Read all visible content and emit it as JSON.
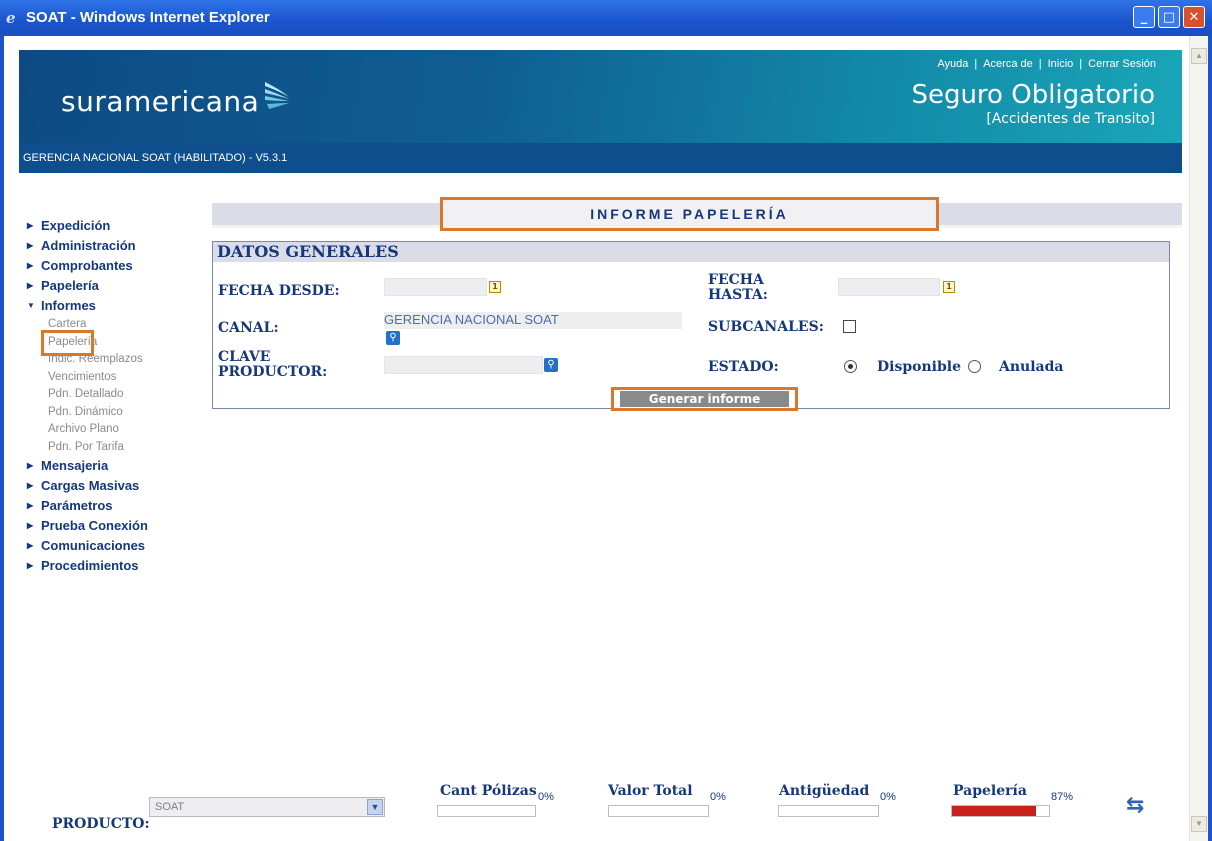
{
  "window": {
    "title": "SOAT - Windows Internet Explorer"
  },
  "header": {
    "logo": "suramericana",
    "links": [
      "Ayuda",
      "Acerca de",
      "Inicio",
      "Cerrar Sesión"
    ],
    "brand_title": "Seguro Obligatorio",
    "brand_subtitle": "[Accidentes de Transito]",
    "subtitle_bar": "GERENCIA NACIONAL SOAT (HABILITADO) - V5.3.1"
  },
  "menu": {
    "items": [
      {
        "label": "Expedición"
      },
      {
        "label": "Administración"
      },
      {
        "label": "Comprobantes"
      },
      {
        "label": "Papelería"
      },
      {
        "label": "Informes",
        "open": true
      }
    ],
    "subitems": [
      "Cartera",
      "Papelería",
      "Indic. Reemplazos",
      "Vencimientos",
      "Pdn. Detallado",
      "Pdn. Dinámico",
      "Archivo Plano",
      "Pdn. Por Tarifa"
    ],
    "items_after": [
      "Mensajeria",
      "Cargas Masivas",
      "Parámetros",
      "Prueba Conexión",
      "Comunicaciones",
      "Procedimientos"
    ]
  },
  "report": {
    "title": "INFORME PAPELERÍA",
    "panel_title": "DATOS GENERALES",
    "fecha_desde_label": "FECHA DESDE:",
    "fecha_hasta_label": "FECHA HASTA:",
    "canal_label": "CANAL:",
    "canal_value": "GERENCIA NACIONAL SOAT",
    "subcanales_label": "SUBCANALES:",
    "clave_label": "CLAVE PRODUCTOR:",
    "estado_label": "ESTADO:",
    "estado_options": [
      "Disponible",
      "Anulada"
    ],
    "estado_selected": "Disponible",
    "generate_button": "Generar informe"
  },
  "footer": {
    "producto_label": "PRODUCTO:",
    "producto_value": "SOAT",
    "indicators": [
      {
        "label": "Cant Pólizas",
        "pct": "0%",
        "value": 0
      },
      {
        "label": "Valor Total",
        "pct": "0%",
        "value": 0
      },
      {
        "label": "Antigüedad",
        "pct": "0%",
        "value": 0
      },
      {
        "label": "Papelería",
        "pct": "87%",
        "value": 87
      }
    ]
  }
}
